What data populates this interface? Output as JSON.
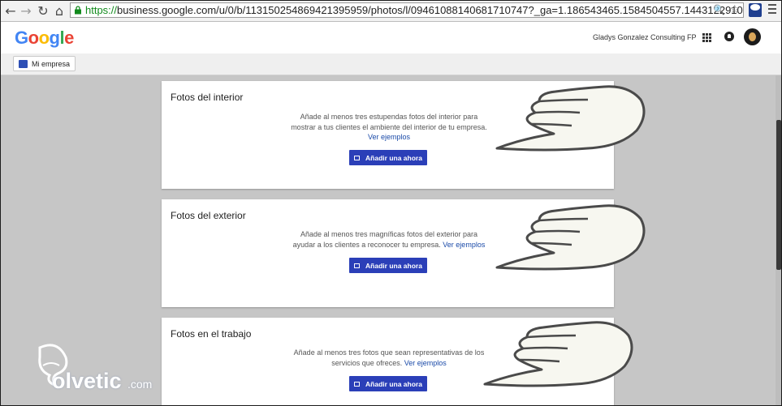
{
  "browser": {
    "url_protocol": "https://",
    "url_rest": "business.google.com/u/0/b/113150254869421395959/photos/l/09461088140681710747?_ga=1.186543465.1584504557.1443122910",
    "back_icon": "arrow-left",
    "forward_icon": "arrow-right",
    "reload_icon": "reload",
    "home_icon": "home",
    "zoom_icon": "magnifier",
    "star_icon": "star"
  },
  "header": {
    "logo": "Google",
    "account_name": "Gladys Gonzalez Consulting FP",
    "logo_colors": [
      "#4285f4",
      "#ea4335",
      "#fbbc05",
      "#4285f4",
      "#34a853",
      "#ea4335"
    ]
  },
  "subbar": {
    "my_business_label": "Mi empresa"
  },
  "cards": [
    {
      "title": "Fotos del interior",
      "desc_line1": "Añade al menos tres estupendas fotos del interior para",
      "desc_line2": "mostrar a tus clientes el ambiente del interior de tu empresa.",
      "link": "Ver ejemplos",
      "button": "Añadir una ahora"
    },
    {
      "title": "Fotos del exterior",
      "desc_line1": "Añade al menos tres magníficas fotos del exterior para",
      "desc_line2": "ayudar a los clientes a reconocer tu empresa.",
      "link": "Ver ejemplos",
      "button": "Añadir una ahora"
    },
    {
      "title": "Fotos en el trabajo",
      "desc_line1": "Añade al menos tres fotos que sean representativas de los",
      "desc_line2": "servicios que ofreces.",
      "link": "Ver ejemplos",
      "button": "Añadir una ahora"
    }
  ],
  "watermark": {
    "text": "olvetic",
    "suffix": ".com"
  },
  "colors": {
    "button": "#2b3fb8",
    "link": "#1a4aa8",
    "url_secure": "#118a1c"
  }
}
